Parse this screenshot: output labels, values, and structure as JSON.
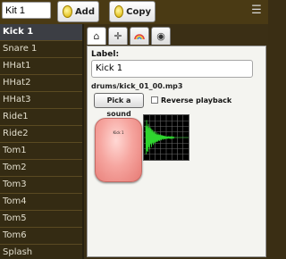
{
  "kit": {
    "name": "Kit 1"
  },
  "toolbar": {
    "add_label": "Add",
    "copy_label": "Copy",
    "menu_glyph": "☰"
  },
  "drums": [
    "Kick 1",
    "Snare 1",
    "HHat1",
    "HHat2",
    "HHat3",
    "Ride1",
    "Ride2",
    "Tom1",
    "Tom2",
    "Tom3",
    "Tom4",
    "Tom5",
    "Tom6",
    "Splash"
  ],
  "selected_drum": "Kick 1",
  "tabs": [
    {
      "icon": "house-icon",
      "glyph": "⌂"
    },
    {
      "icon": "crosshair-icon",
      "glyph": "✛"
    },
    {
      "icon": "rainbow-icon",
      "glyph": "◠"
    },
    {
      "icon": "eye-icon",
      "glyph": "◉"
    }
  ],
  "editor": {
    "label_caption": "Label:",
    "label_value": "Kick 1",
    "file_path": "drums/kick_01_00.mp3",
    "pick_sound_label": "Pick a sound",
    "reverse_label": "Reverse playback",
    "reverse_checked": false,
    "pad_label": "Kick 1"
  },
  "colors": {
    "background": "#3a2e14",
    "pad": "#f6a6a0",
    "waveform": "#2fd62f",
    "grid": "#6a6a6a"
  }
}
